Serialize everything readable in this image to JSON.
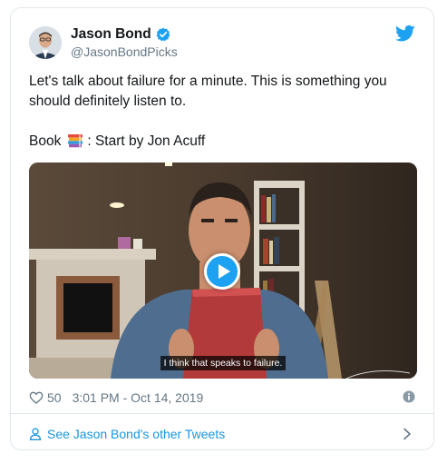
{
  "tweet": {
    "author": {
      "display_name": "Jason Bond",
      "handle": "@JasonBondPicks",
      "verified": true
    },
    "text_line1": "Let's talk about failure for a minute. This is something you should definitely listen to.",
    "book_prefix": "Book",
    "book_suffix": ": Start by Jon Acuff",
    "video": {
      "caption": "I think that speaks to failure."
    },
    "likes": "50",
    "timestamp": "3:01 PM - Oct 14, 2019"
  },
  "footer": {
    "link_label": "See Jason Bond's other Tweets"
  },
  "colors": {
    "brand_blue": "#1da1f2",
    "link_blue": "#1b95e0",
    "secondary_text": "#657786",
    "border": "#e1e8ed"
  },
  "icons": {
    "verified": "verified-badge-icon",
    "brand": "twitter-bird-icon",
    "books": "books-emoji-icon",
    "play": "play-icon",
    "like": "heart-icon",
    "info": "info-icon",
    "person": "person-icon",
    "chevron": "chevron-right-icon"
  }
}
